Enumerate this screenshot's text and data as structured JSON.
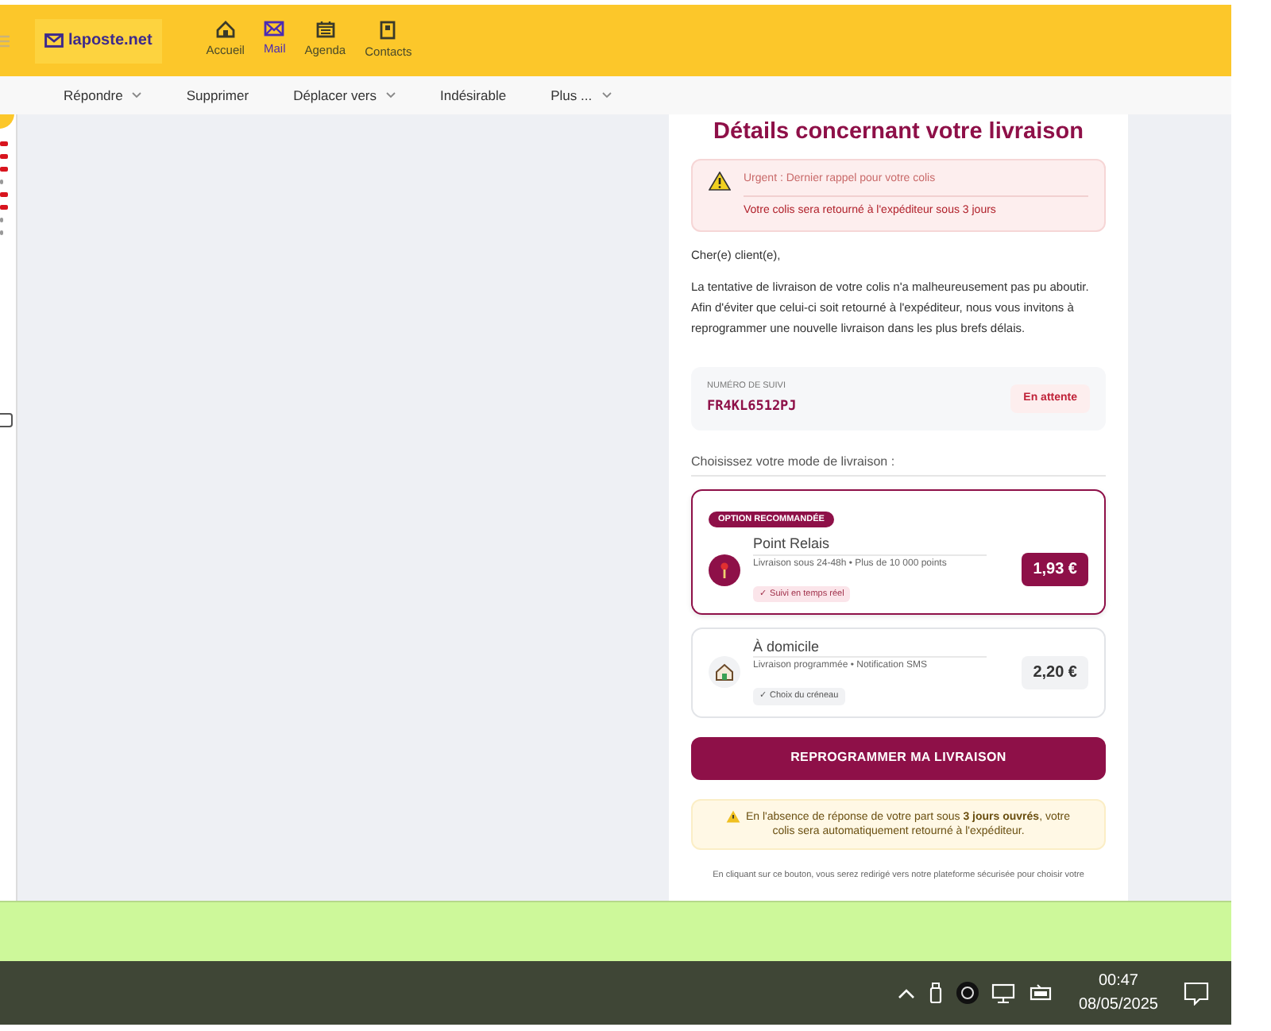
{
  "app": {
    "logo": "laposte.net"
  },
  "nav": [
    {
      "label": "Accueil",
      "kind": "home",
      "selected": false
    },
    {
      "label": "Mail",
      "kind": "mail",
      "selected": true
    },
    {
      "label": "Agenda",
      "kind": "calendar",
      "selected": false
    },
    {
      "label": "Contacts",
      "kind": "contact",
      "selected": false
    }
  ],
  "toolbar": [
    {
      "label": "Répondre",
      "dropdown": true
    },
    {
      "label": "Supprimer",
      "dropdown": false
    },
    {
      "label": "Déplacer vers",
      "dropdown": true
    },
    {
      "label": "Indésirable",
      "dropdown": false
    },
    {
      "label": "Plus ...",
      "dropdown": true
    }
  ],
  "sidebar": {
    "rows": [
      {
        "unread": true
      },
      {
        "unread": true
      },
      {
        "unread": true
      },
      {
        "unread": false
      },
      {
        "unread": true
      },
      {
        "unread": true
      },
      {
        "unread": false
      },
      {
        "unread": false
      }
    ],
    "checkbox": {
      "checked": false
    }
  },
  "email": {
    "title": "Détails concernant votre livraison",
    "alert": {
      "title": "Urgent : Dernier rappel pour votre colis",
      "text": "Votre colis sera retourné à l'expéditeur sous 3 jours"
    },
    "greeting": "Cher(e) client(e),",
    "body": "La tentative de livraison de votre colis n'a malheureusement pas pu aboutir. Afin d'éviter que celui-ci soit retourné à l'expéditeur, nous vous invitons à reprogrammer une nouvelle livraison dans les plus brefs délais.",
    "tracking": {
      "label": "NUMÉRO DE SUIVI",
      "number": "FR4KL6512PJ",
      "status": "En attente"
    },
    "choose_label": "Choisissez votre mode de livraison :",
    "options": [
      {
        "badge": "OPTION RECOMMANDÉE",
        "kind": "pin",
        "name": "Point Relais",
        "description": "Livraison sous 24-48h • Plus de 10 000 points",
        "feature": "✓ Suivi en temps réel",
        "price": "1,93 €",
        "selected": true
      },
      {
        "kind": "house",
        "name": "À domicile",
        "description": "Livraison programmée • Notification SMS",
        "feature": "✓ Choix du créneau",
        "price": "2,20 €",
        "selected": false
      }
    ],
    "button": "REPROGRAMMER MA LIVRAISON",
    "notice": "En l'absence de réponse de votre part sous **3 jours ouvrés**, votre colis sera automatiquement retourné à l'expéditeur.",
    "footer": "En cliquant sur ce bouton, vous serez redirigé vers notre plateforme sécurisée pour choisir votre"
  },
  "taskbar": {
    "time": "00:47",
    "date": "08/05/2025"
  }
}
